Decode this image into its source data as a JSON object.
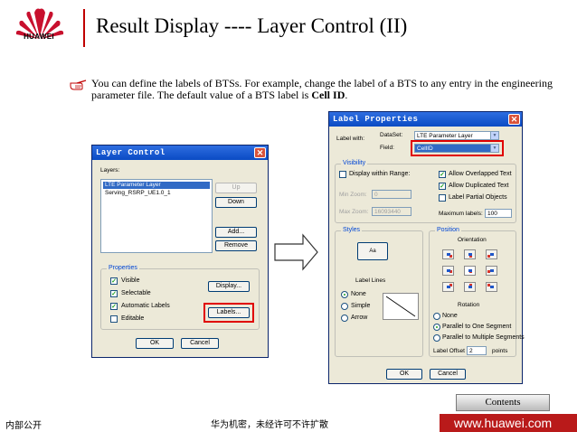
{
  "brand": {
    "logo_text": "HUAWEI",
    "accent": "#c00000"
  },
  "page": {
    "title": "Result Display ---- Layer Control (II)",
    "bullet_pre": "You can define the labels of BTSs. For example, change the label of a BTS to any entry in the engineering parameter file. The default value of a BTS label is ",
    "bullet_bold": "Cell ID",
    "bullet_post": "."
  },
  "layer_control": {
    "title": "Layer Control",
    "layers_label": "Layers:",
    "layers": [
      "LTE Parameter Layer",
      "Serving_RSRP_UE1.0_1"
    ],
    "buttons": {
      "up": "Up",
      "down": "Down",
      "add": "Add...",
      "remove": "Remove",
      "display": "Display...",
      "labels": "Labels...",
      "ok": "OK",
      "cancel": "Cancel"
    },
    "properties_label": "Properties",
    "properties": [
      {
        "label": "Visible",
        "checked": true
      },
      {
        "label": "Selectable",
        "checked": true
      },
      {
        "label": "Automatic Labels",
        "checked": true
      },
      {
        "label": "Editable",
        "checked": false
      }
    ]
  },
  "label_properties": {
    "title": "Label Properties",
    "label_with": "Label with:",
    "dataset_label": "DataSet:",
    "dataset_value": "LTE Parameter Layer",
    "field_label": "Field:",
    "field_value": "CellID",
    "visibility_label": "Visibility",
    "display_within_range": "Display within Range:",
    "min_zoom_label": "Min Zoom:",
    "min_zoom_value": "0",
    "max_zoom_label": "Max Zoom:",
    "max_zoom_value": "16093440",
    "allow_overlapped": "Allow Overlapped Text",
    "allow_duplicated": "Allow Duplicated Text",
    "label_partial": "Label Partial Objects",
    "max_labels_label": "Maximum labels:",
    "max_labels_value": "100",
    "styles_label": "Styles",
    "style_sample": "Aa",
    "label_lines_label": "Label Lines",
    "label_lines": [
      "None",
      "Simple",
      "Arrow"
    ],
    "position_label": "Position",
    "orientation_label": "Orientation",
    "rotation_label": "Rotation",
    "rotation_options": [
      "None",
      "Parallel to One Segment",
      "Parallel to Multiple Segments"
    ],
    "label_offset_label": "Label Offset",
    "label_offset_value": "2",
    "label_offset_unit": "points",
    "ok": "OK",
    "cancel": "Cancel"
  },
  "footer": {
    "contents": "Contents",
    "left": "内部公开",
    "middle": "华为机密，未经许可不许扩散",
    "url": "www.huawei.com"
  }
}
